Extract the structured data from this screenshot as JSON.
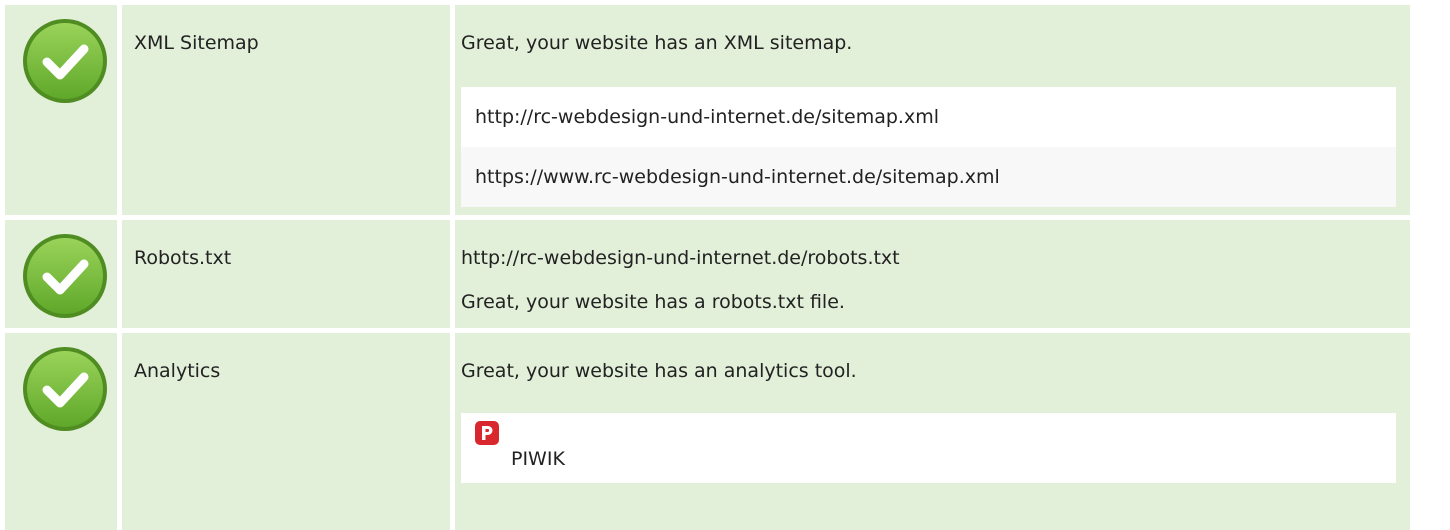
{
  "colors": {
    "row_bg": "#e2efd9",
    "check_green": "#7cc043",
    "piwik_red": "#d9272e"
  },
  "checks": [
    {
      "icon": "check-circle-icon",
      "label": "XML Sitemap",
      "message": "Great, your website has an XML sitemap.",
      "urls": [
        "http://rc-webdesign-und-internet.de/sitemap.xml",
        "https://www.rc-webdesign-und-internet.de/sitemap.xml"
      ]
    },
    {
      "icon": "check-circle-icon",
      "label": "Robots.txt",
      "url": "http://rc-webdesign-und-internet.de/robots.txt",
      "message": "Great, your website has a robots.txt file."
    },
    {
      "icon": "check-circle-icon",
      "label": "Analytics",
      "message": "Great, your website has an analytics tool.",
      "tools": [
        {
          "icon": "piwik-logo-icon",
          "name": "PIWIK"
        }
      ]
    }
  ]
}
